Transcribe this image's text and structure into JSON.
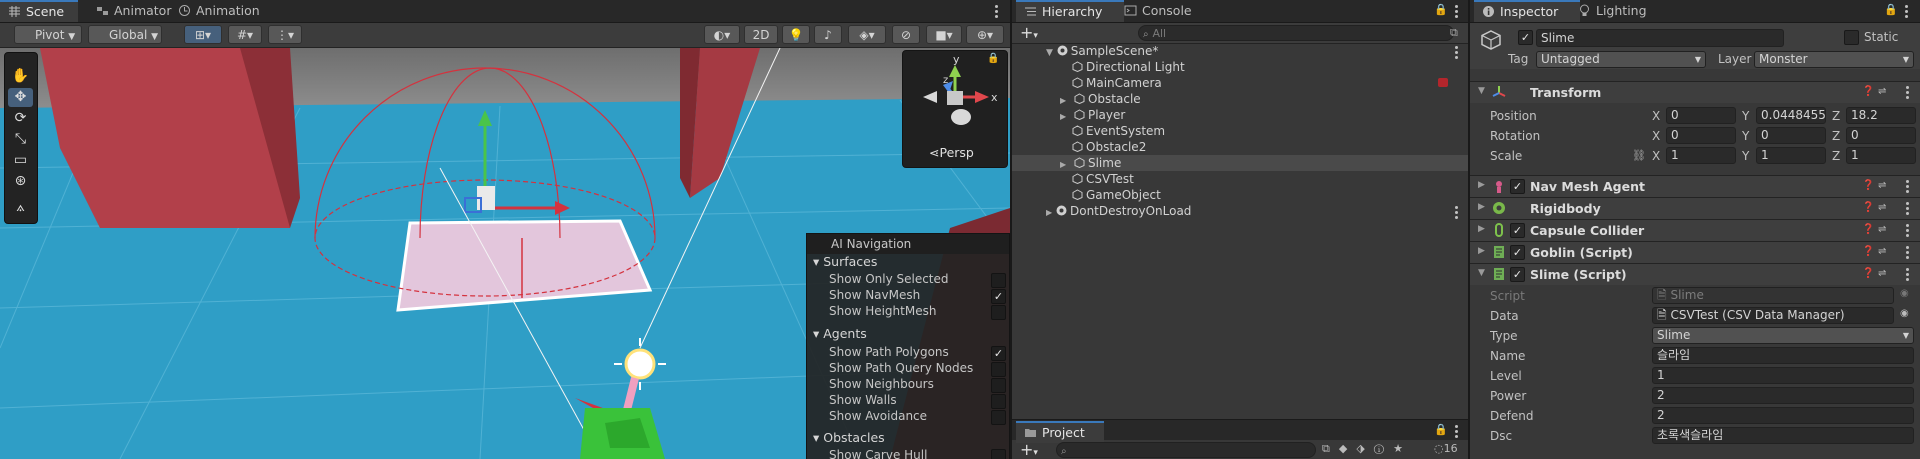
{
  "scene_panel": {
    "tabs": [
      {
        "label": "Scene",
        "icon": "scene-grid-icon"
      },
      {
        "label": "Animator",
        "icon": "animator-icon"
      },
      {
        "label": "Animation",
        "icon": "animation-clock-icon"
      }
    ],
    "pivot_label": "Pivot",
    "global_label": "Global",
    "mode_2d_label": "2D",
    "gizmo_view_label": "Persp",
    "gizmo_axes": {
      "x": "x",
      "y": "y",
      "z": "z"
    },
    "nav_overlay": {
      "title": "AI Navigation",
      "sections": [
        {
          "label": "Surfaces",
          "rows": [
            {
              "label": "Show Only Selected",
              "checked": false
            },
            {
              "label": "Show NavMesh",
              "checked": true
            },
            {
              "label": "Show HeightMesh",
              "checked": false
            }
          ]
        },
        {
          "label": "Agents",
          "rows": [
            {
              "label": "Show Path Polygons",
              "checked": true
            },
            {
              "label": "Show Path Query Nodes",
              "checked": false
            },
            {
              "label": "Show Neighbours",
              "checked": false
            },
            {
              "label": "Show Walls",
              "checked": false
            },
            {
              "label": "Show Avoidance",
              "checked": false
            }
          ]
        },
        {
          "label": "Obstacles",
          "rows": [
            {
              "label": "Show Carve Hull",
              "checked": false
            }
          ]
        }
      ]
    }
  },
  "hierarchy_panel": {
    "tabs": [
      {
        "label": "Hierarchy",
        "icon": "hierarchy-list-icon"
      },
      {
        "label": "Console",
        "icon": "console-icon"
      }
    ],
    "search_placeholder": "All",
    "items": [
      {
        "label": "SampleScene*",
        "kind": "scene"
      },
      {
        "label": "Directional Light",
        "kind": "object"
      },
      {
        "label": "MainCamera",
        "kind": "object"
      },
      {
        "label": "Obstacle",
        "kind": "object",
        "expandable": true
      },
      {
        "label": "Player",
        "kind": "object",
        "expandable": true
      },
      {
        "label": "EventSystem",
        "kind": "object"
      },
      {
        "label": "Obstacle2",
        "kind": "object"
      },
      {
        "label": "Slime",
        "kind": "object",
        "expandable": true,
        "selected": true
      },
      {
        "label": "CSVTest",
        "kind": "object"
      },
      {
        "label": "GameObject",
        "kind": "object"
      },
      {
        "label": "DontDestroyOnLoad",
        "kind": "scene"
      }
    ],
    "project_tab": {
      "label": "Project",
      "icon": "project-folder-icon"
    },
    "hidden_count": "16"
  },
  "inspector_panel": {
    "tabs": [
      {
        "label": "Inspector",
        "icon": "info-icon"
      },
      {
        "label": "Lighting",
        "icon": "bulb-icon"
      }
    ],
    "object_name": "Slime",
    "static_label": "Static",
    "tag_label": "Tag",
    "tag_value": "Untagged",
    "layer_label": "Layer",
    "layer_value": "Monster",
    "transform": {
      "title": "Transform",
      "rows": [
        {
          "label": "Position",
          "x": "0",
          "y": "0.0448455",
          "z": "18.2"
        },
        {
          "label": "Rotation",
          "x": "0",
          "y": "0",
          "z": "0"
        },
        {
          "label": "Scale",
          "x": "1",
          "y": "1",
          "z": "1"
        }
      ],
      "axis": {
        "x": "X",
        "y": "Y",
        "z": "Z"
      }
    },
    "components": [
      {
        "label": "Nav Mesh Agent",
        "checkbox": true,
        "icon": "nav-agent-icon",
        "color": "#d65a8a"
      },
      {
        "label": "Rigidbody",
        "checkbox": false,
        "icon": "rigidbody-icon",
        "color": "#79b84a"
      },
      {
        "label": "Capsule Collider",
        "checkbox": true,
        "icon": "capsule-collider-icon",
        "color": "#7ec24c"
      },
      {
        "label": "Goblin (Script)",
        "checkbox": true,
        "icon": "script-icon",
        "color": "#6fae55"
      },
      {
        "label": "Slime (Script)",
        "checkbox": true,
        "icon": "script-icon",
        "color": "#6fae55"
      }
    ],
    "slime_script": {
      "script_label": "Script",
      "script_value": "Slime",
      "fields": [
        {
          "label": "Data",
          "value": "CSVTest (CSV Data Manager)"
        },
        {
          "label": "Type",
          "value": "Slime"
        },
        {
          "label": "Name",
          "value": "슬라임"
        },
        {
          "label": "Level",
          "value": "1"
        },
        {
          "label": "Power",
          "value": "2"
        },
        {
          "label": "Defend",
          "value": "2"
        },
        {
          "label": "Dsc",
          "value": "초록색슬라임"
        }
      ]
    }
  }
}
